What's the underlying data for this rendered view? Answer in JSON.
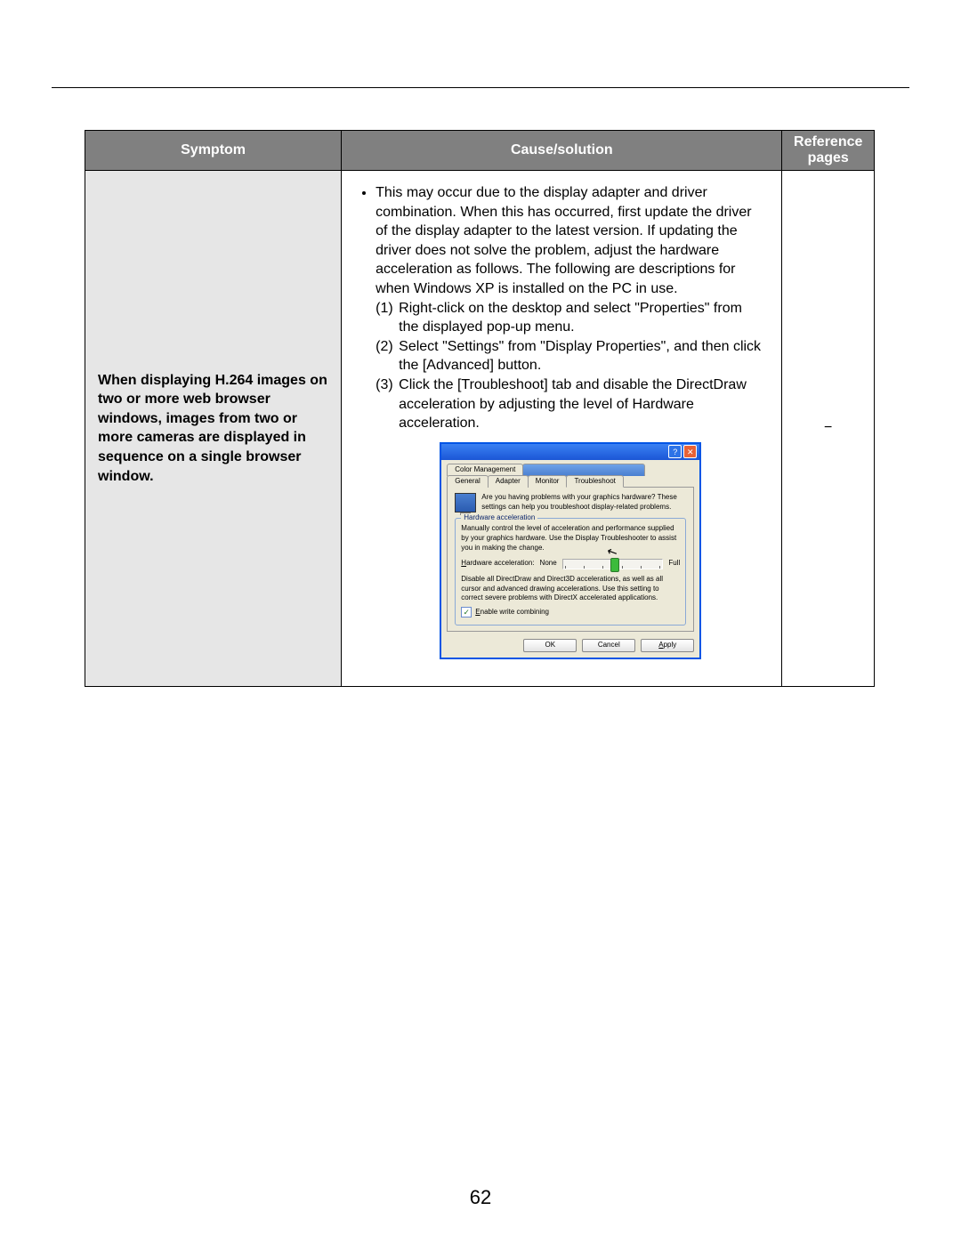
{
  "page_number": "62",
  "table": {
    "headers": {
      "symptom": "Symptom",
      "cause": "Cause/solution",
      "reference": "Reference pages"
    },
    "row": {
      "symptom": "When displaying H.264 images on two or more web browser windows, images from two or more cameras are displayed in sequence on a single browser window.",
      "reference": "−",
      "bullet_intro": "This may occur due to the display adapter and driver combination. When this has occurred, first update the driver of the display adapter to the latest version. If updating the driver does not solve the problem, adjust the hardware acceleration as follows. The following are descriptions for when Windows XP is installed on the PC in use.",
      "steps": {
        "s1_num": "(1)",
        "s1": "Right-click on the desktop and select \"Properties\" from the displayed pop-up menu.",
        "s2_num": "(2)",
        "s2": "Select \"Settings\" from \"Display Properties\", and then click the [Advanced] button.",
        "s3_num": "(3)",
        "s3": "Click the [Troubleshoot] tab and disable the DirectDraw acceleration by adjusting the level of Hardware acceleration."
      }
    }
  },
  "dialog": {
    "help_glyph": "?",
    "close_glyph": "✕",
    "tabs": {
      "color_management": "Color Management",
      "obscured": "———",
      "general": "General",
      "adapter": "Adapter",
      "monitor": "Monitor",
      "troubleshoot": "Troubleshoot"
    },
    "intro": "Are you having problems with your graphics hardware? These settings can help you troubleshoot display-related problems.",
    "fieldset_title": "Hardware acceleration",
    "fieldset_desc": "Manually control the level of acceleration and performance supplied by your graphics hardware. Use the Display Troubleshooter to assist you in making the change.",
    "slider_label": "Hardware acceleration:",
    "slider_none": "None",
    "slider_full": "Full",
    "arrow": "↖",
    "result_desc": "Disable all DirectDraw and Direct3D accelerations, as well as all cursor and advanced drawing accelerations. Use this setting to correct severe problems with DirectX accelerated applications.",
    "checkbox_label": "Enable write combining",
    "check_glyph": "✓",
    "buttons": {
      "ok": "OK",
      "cancel": "Cancel",
      "apply": "Apply"
    }
  }
}
